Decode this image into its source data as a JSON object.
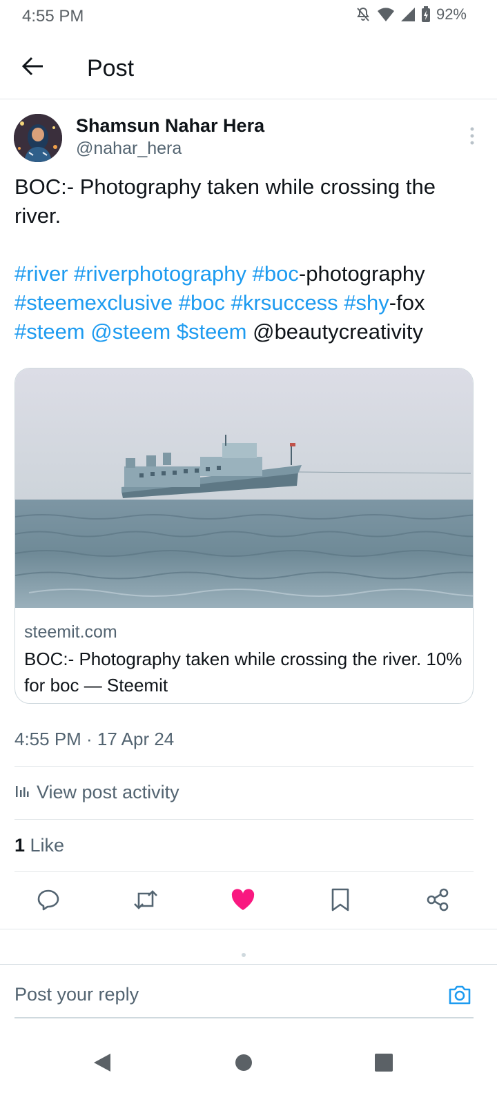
{
  "status_bar": {
    "time": "4:55 PM",
    "battery": "92%",
    "icons": [
      "notifications-off-icon",
      "wifi-icon",
      "signal-icon",
      "battery-charging-icon"
    ]
  },
  "header": {
    "title": "Post",
    "back_icon": "arrow-left-icon"
  },
  "post": {
    "author_name": "Shamsun Nahar Hera",
    "author_handle": "@nahar_hera",
    "text_line": "BOC:- Photography taken while crossing the river.",
    "hashtag_segments": [
      {
        "text": "#river",
        "link": true
      },
      {
        "text": " ",
        "link": false
      },
      {
        "text": "#riverphotography",
        "link": true
      },
      {
        "text": " ",
        "link": false
      },
      {
        "text": "#boc",
        "link": true
      },
      {
        "text": "-photography ",
        "link": false
      },
      {
        "text": "#steemexclusive",
        "link": true
      },
      {
        "text": " ",
        "link": false
      },
      {
        "text": "#boc",
        "link": true
      },
      {
        "text": " ",
        "link": false
      },
      {
        "text": "#krsuccess",
        "link": true
      },
      {
        "text": " ",
        "link": false
      },
      {
        "text": "#shy",
        "link": true
      },
      {
        "text": "-fox ",
        "link": false
      },
      {
        "text": "#steem",
        "link": true
      },
      {
        "text": " ",
        "link": false
      },
      {
        "text": "@steem",
        "link": true
      },
      {
        "text": " ",
        "link": false
      },
      {
        "text": "$steem",
        "link": true
      },
      {
        "text": " @beautycreativity",
        "link": false
      }
    ],
    "link_card": {
      "domain": "steemit.com",
      "title": "BOC:- Photography taken while crossing the river. 10% for boc — Steemit"
    },
    "timestamp": "4:55 PM · 17 Apr 24",
    "view_activity_label": "View post activity",
    "like_count": "1",
    "like_label": " Like"
  },
  "actions": [
    "reply-icon",
    "repost-icon",
    "like-icon",
    "bookmark-icon",
    "share-icon"
  ],
  "reply": {
    "placeholder": "Post your reply"
  },
  "colors": {
    "link": "#1d9bf0",
    "like_active": "#f91880",
    "secondary_text": "#536471"
  }
}
